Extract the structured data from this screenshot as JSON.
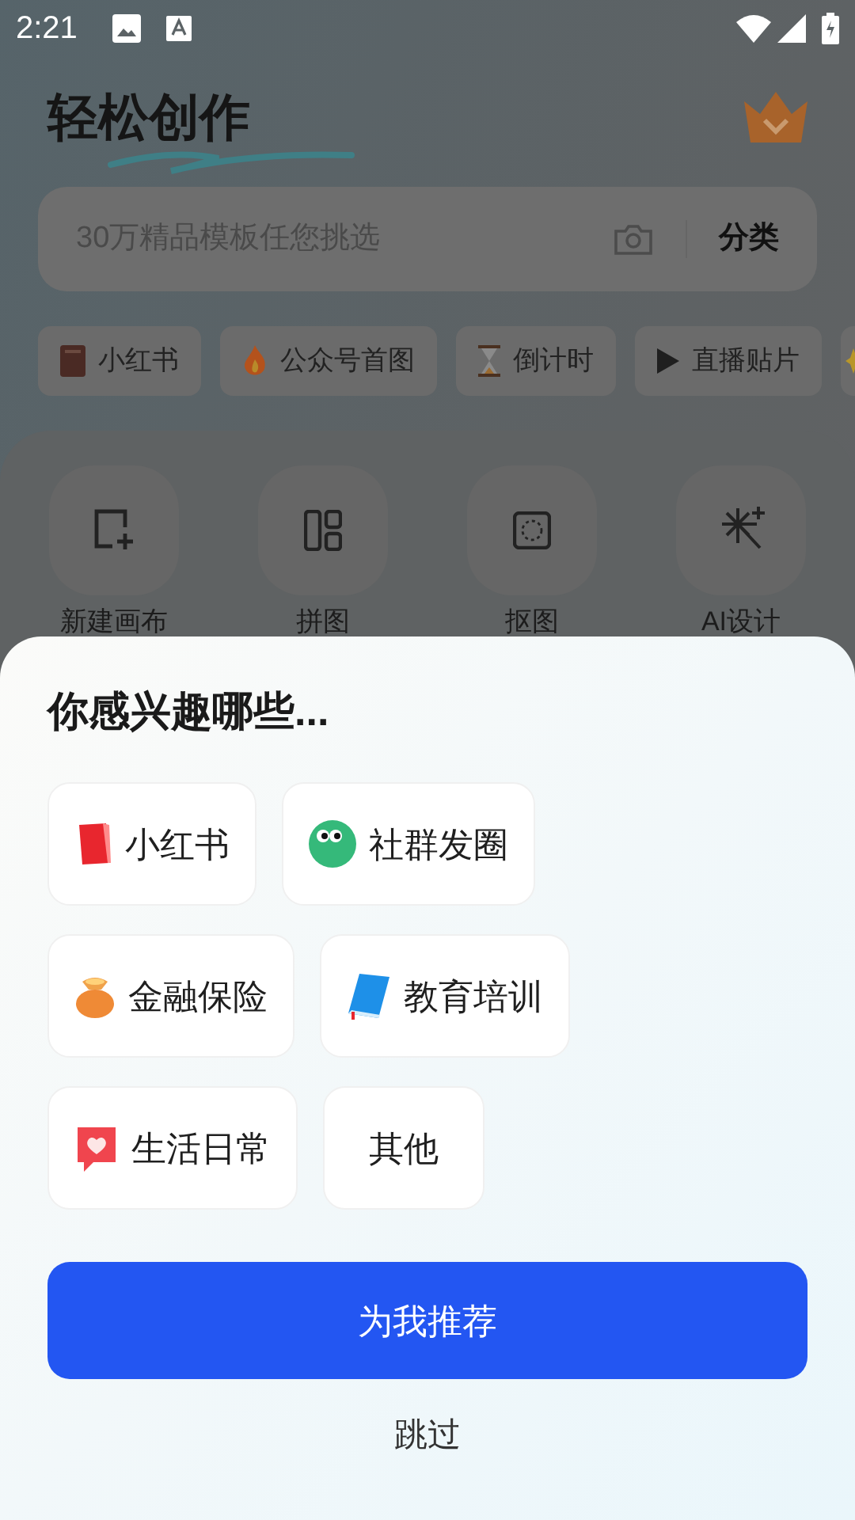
{
  "status_bar": {
    "time": "2:21"
  },
  "header": {
    "title": "轻松创作"
  },
  "search": {
    "placeholder": "30万精品模板任您挑选",
    "category_button": "分类"
  },
  "quick_tags": [
    {
      "label": "小红书"
    },
    {
      "label": "公众号首图"
    },
    {
      "label": "倒计时"
    },
    {
      "label": "直播贴片"
    }
  ],
  "tools": [
    {
      "label": "新建画布"
    },
    {
      "label": "拼图"
    },
    {
      "label": "抠图"
    },
    {
      "label": "AI设计"
    }
  ],
  "interest_sheet": {
    "title": "你感兴趣哪些...",
    "options": [
      {
        "label": "小红书",
        "kind": "icon"
      },
      {
        "label": "社群发圈",
        "kind": "icon"
      },
      {
        "label": "金融保险",
        "kind": "icon"
      },
      {
        "label": "教育培训",
        "kind": "icon"
      },
      {
        "label": "生活日常",
        "kind": "icon"
      },
      {
        "label": "其他",
        "kind": "plain"
      }
    ],
    "primary_button": "为我推荐",
    "skip_link": "跳过"
  }
}
